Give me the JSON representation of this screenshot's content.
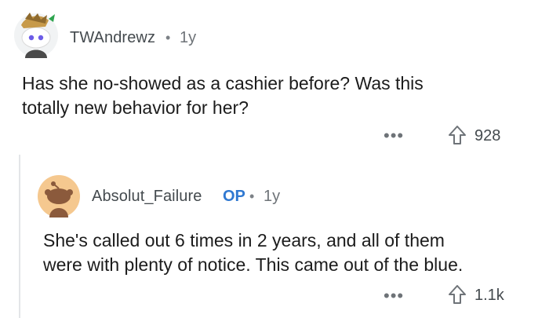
{
  "comments": [
    {
      "username": "TWAndrewz",
      "separator": "•",
      "age": "1y",
      "body_lines": [
        "Has she no-showed as a cashier before? Was this",
        "totally new behavior for her?"
      ],
      "more_label": "•••",
      "score": "928",
      "icons": {
        "avatar": "snoo-avatar-icon",
        "upvote": "upvote-arrow-icon"
      }
    },
    {
      "username": "Absolut_Failure",
      "op_badge": "OP",
      "separator": "•",
      "age": "1y",
      "body_lines": [
        "She's called out 6 times in 2 years, and all of them",
        "were with plenty of notice. This came out of the blue."
      ],
      "more_label": "•••",
      "score": "1.1k",
      "icons": {
        "avatar": "snoo-avatar-icon",
        "upvote": "upvote-arrow-icon"
      }
    }
  ],
  "colors": {
    "op_badge": "#2f78d1",
    "avatar_reply_bg": "#f5c88f",
    "thread_line": "#e3e5e8"
  }
}
